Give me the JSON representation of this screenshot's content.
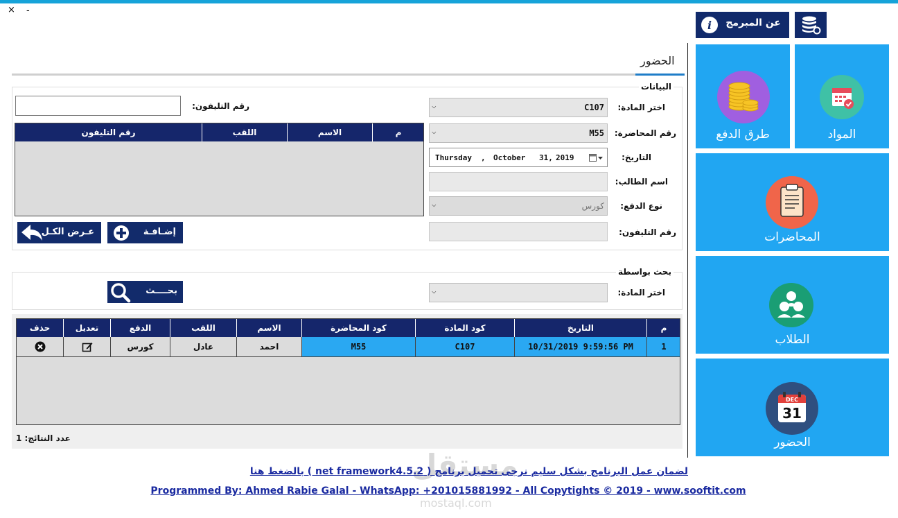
{
  "window": {
    "close_glyph": "×",
    "minimize_glyph": "-"
  },
  "sidebar": {
    "about_button_label": "عن المبرمج",
    "about_icon": "info-icon",
    "database_icon": "database-icon",
    "tiles": [
      {
        "label": "المواد",
        "icon": "calendar-check-icon"
      },
      {
        "label": "طرق الدفع",
        "icon": "coins-icon"
      },
      {
        "label": "المحاضرات",
        "icon": "clipboard-icon"
      },
      {
        "label": "الطلاب",
        "icon": "users-icon"
      },
      {
        "label": "الحضور",
        "icon": "calendar-icon",
        "icon_month": "DEC",
        "icon_day": "31"
      }
    ],
    "colors": {
      "tile": "#21a6f2",
      "navy": "#112a6b"
    }
  },
  "tab": {
    "title": "الحضور"
  },
  "data_group": {
    "title": "البيانات",
    "subject_label": "اختر المادة:",
    "subject_value": "C107",
    "lecture_label": "رقم المحاضرة:",
    "lecture_value": "M55",
    "date_label": "التاريخ:",
    "date_day": "Thursday",
    "date_month": "October",
    "date_daynum": "31,",
    "date_year": "2019",
    "student_label": "اسم الطالب:",
    "student_value": "",
    "payment_label": "نوع الدفع:",
    "payment_value": "كورس",
    "phone_label": "رقم التليفون:",
    "phone_value": "",
    "phone_search_label": "رقم التليفون:",
    "phone_search_value": "",
    "student_grid_headers": [
      "م",
      "الاسم",
      "اللقب",
      "رقم التليفون"
    ],
    "add_button": "إضـافـة",
    "show_all_button": "عـرض الكـل"
  },
  "search_group": {
    "title": "بحث بواسطة",
    "subject_label": "اختر المادة:",
    "subject_value": "",
    "search_button": "بحــــث"
  },
  "results": {
    "headers": [
      "م",
      "التاريخ",
      "كود المادة",
      "كود المحاضرة",
      "الاسم",
      "اللقب",
      "الدفع",
      "تعديل",
      "حذف"
    ],
    "rows": [
      {
        "num": "1",
        "date": "10/31/2019 9:59:56 PM",
        "subject_code": "C107",
        "lecture_code": "M55",
        "name": "احمد",
        "surname": "عادل",
        "payment": "كورس",
        "edit_icon": "edit-icon",
        "delete_icon": "delete-circle-icon"
      }
    ],
    "count_label": "عدد النتائج: 1"
  },
  "footer": {
    "line1": "لضمان عمل البرنامج بشكل سليم نرجى تحميل برنامج ( net framework4.5.2 ) بالضغط هنا",
    "line2": "Programmed By: Ahmed Rabie Galal - WhatsApp: +201015881992 - All Copytights © 2019 - www.sooftit.com"
  },
  "watermark": {
    "arabic": "مستقل",
    "latin": "mostaql.com"
  }
}
